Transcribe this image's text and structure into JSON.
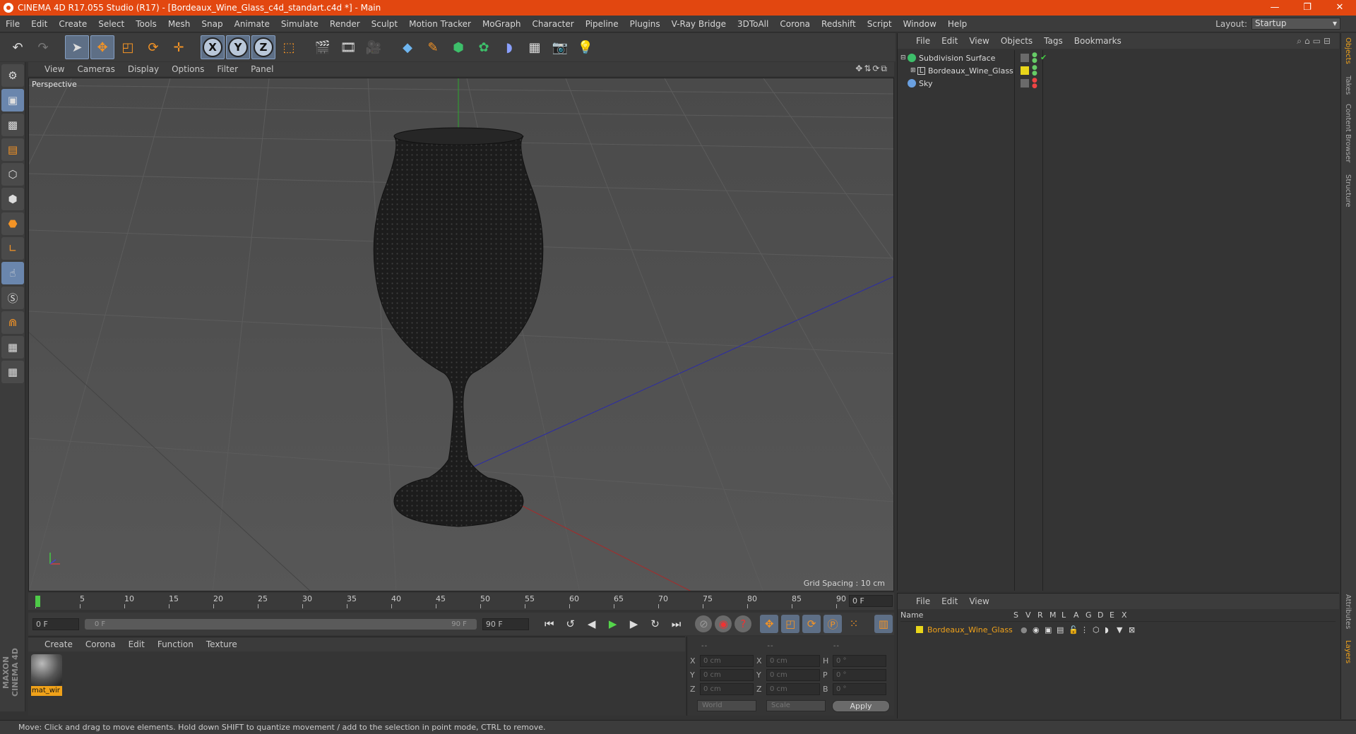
{
  "window": {
    "title": "CINEMA 4D R17.055 Studio (R17) - [Bordeaux_Wine_Glass_c4d_standart.c4d *] - Main",
    "minimize": "—",
    "restore": "❐",
    "close": "✕"
  },
  "menu": [
    "File",
    "Edit",
    "Create",
    "Select",
    "Tools",
    "Mesh",
    "Snap",
    "Animate",
    "Simulate",
    "Render",
    "Sculpt",
    "Motion Tracker",
    "MoGraph",
    "Character",
    "Pipeline",
    "Plugins",
    "V-Ray Bridge",
    "3DToAll",
    "Corona",
    "Redshift",
    "Script",
    "Window",
    "Help"
  ],
  "layout": {
    "label": "Layout:",
    "value": "Startup"
  },
  "viewport": {
    "menu": [
      "View",
      "Cameras",
      "Display",
      "Options",
      "Filter",
      "Panel"
    ],
    "label": "Perspective",
    "grid_spacing": "Grid Spacing : 10 cm"
  },
  "timeline": {
    "ticks": [
      "0",
      "5",
      "10",
      "15",
      "20",
      "25",
      "30",
      "35",
      "40",
      "45",
      "50",
      "55",
      "60",
      "65",
      "70",
      "75",
      "80",
      "85",
      "90"
    ],
    "current": "0 F"
  },
  "transport": {
    "start": "0 F",
    "slider_start": "0 F",
    "slider_end": "90 F",
    "end": "90 F"
  },
  "materials": {
    "menu": [
      "Create",
      "Corona",
      "Edit",
      "Function",
      "Texture"
    ],
    "items": [
      {
        "name": "mat_wir"
      }
    ]
  },
  "coords": {
    "header": [
      "--",
      "--",
      "--"
    ],
    "rows": [
      {
        "l1": "X",
        "v1": "0 cm",
        "l2": "X",
        "v2": "0 cm",
        "l3": "H",
        "v3": "0 °"
      },
      {
        "l1": "Y",
        "v1": "0 cm",
        "l2": "Y",
        "v2": "0 cm",
        "l3": "P",
        "v3": "0 °"
      },
      {
        "l1": "Z",
        "v1": "0 cm",
        "l2": "Z",
        "v2": "0 cm",
        "l3": "B",
        "v3": "0 °"
      }
    ],
    "space": "World",
    "mode": "Scale",
    "apply": "Apply"
  },
  "objects": {
    "menu": [
      "File",
      "Edit",
      "View",
      "Objects",
      "Tags",
      "Bookmarks"
    ],
    "items": [
      {
        "name": "Subdivision Surface",
        "icon_color": "#3dbf6a"
      },
      {
        "name": "Bordeaux_Wine_Glass",
        "icon_color": "#c8c8c8"
      },
      {
        "name": "Sky",
        "icon_color": "#6aa0e0"
      }
    ]
  },
  "layers": {
    "menu": [
      "File",
      "Edit",
      "View"
    ],
    "columns": [
      "Name",
      "S",
      "V",
      "R",
      "M",
      "L",
      "A",
      "G",
      "D",
      "E",
      "X"
    ],
    "items": [
      {
        "name": "Bordeaux_Wine_Glass",
        "color": "#e9d61a"
      }
    ]
  },
  "side_tabs": [
    "Objects",
    "Takes",
    "Content Browser",
    "Structure"
  ],
  "side_tabs_bottom": [
    "Attributes",
    "Layers"
  ],
  "status": "Move: Click and drag to move elements. Hold down SHIFT to quantize movement / add to the selection in point mode, CTRL to remove.",
  "brand": "MAXON CINEMA 4D",
  "colors": {
    "accent": "#e24710",
    "selection": "#f0a21a",
    "axis_x": "#c83030",
    "axis_y": "#30b030",
    "axis_z": "#3030c0"
  }
}
